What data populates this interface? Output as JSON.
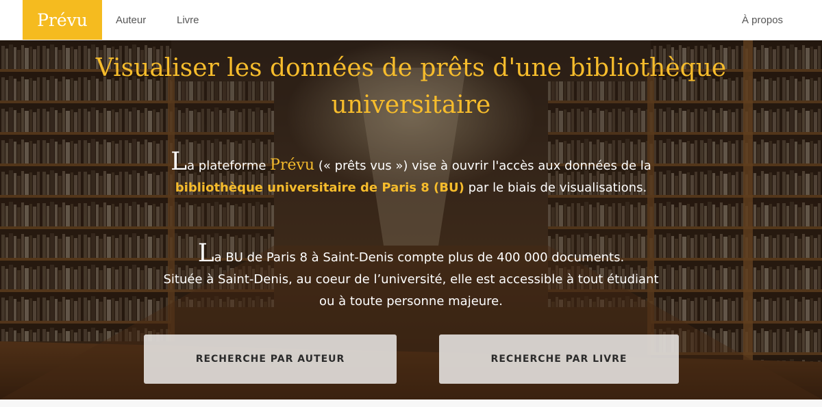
{
  "navbar": {
    "brand": "Prévu",
    "links": {
      "author": "Auteur",
      "book": "Livre",
      "about": "À propos"
    }
  },
  "hero": {
    "title": "Visualiser les données de prêts d'une bibliothèque universitaire",
    "paragraph1": {
      "dropcap": "L",
      "text_before": "a plateforme ",
      "brand": "Prévu",
      "text_middle": " (« prêts vus ») vise à ouvrir l'accès aux données de la ",
      "highlight": "bibliothèque universitaire de Paris 8 (BU)",
      "text_after": " par le biais de visualisations."
    },
    "paragraph2": {
      "dropcap": "L",
      "line1": "a BU de Paris 8 à Saint-Denis compte plus de 400 000 documents.",
      "line2": "Située à Saint-Denis, au coeur de l’université, elle est accessible à tout étudiant ou à toute personne majeure."
    },
    "buttons": {
      "author": "RECHERCHE PAR AUTEUR",
      "book": "RECHERCHE PAR LIVRE"
    }
  },
  "colors": {
    "accent": "#f5bb1f",
    "title": "#f6bc2c"
  }
}
